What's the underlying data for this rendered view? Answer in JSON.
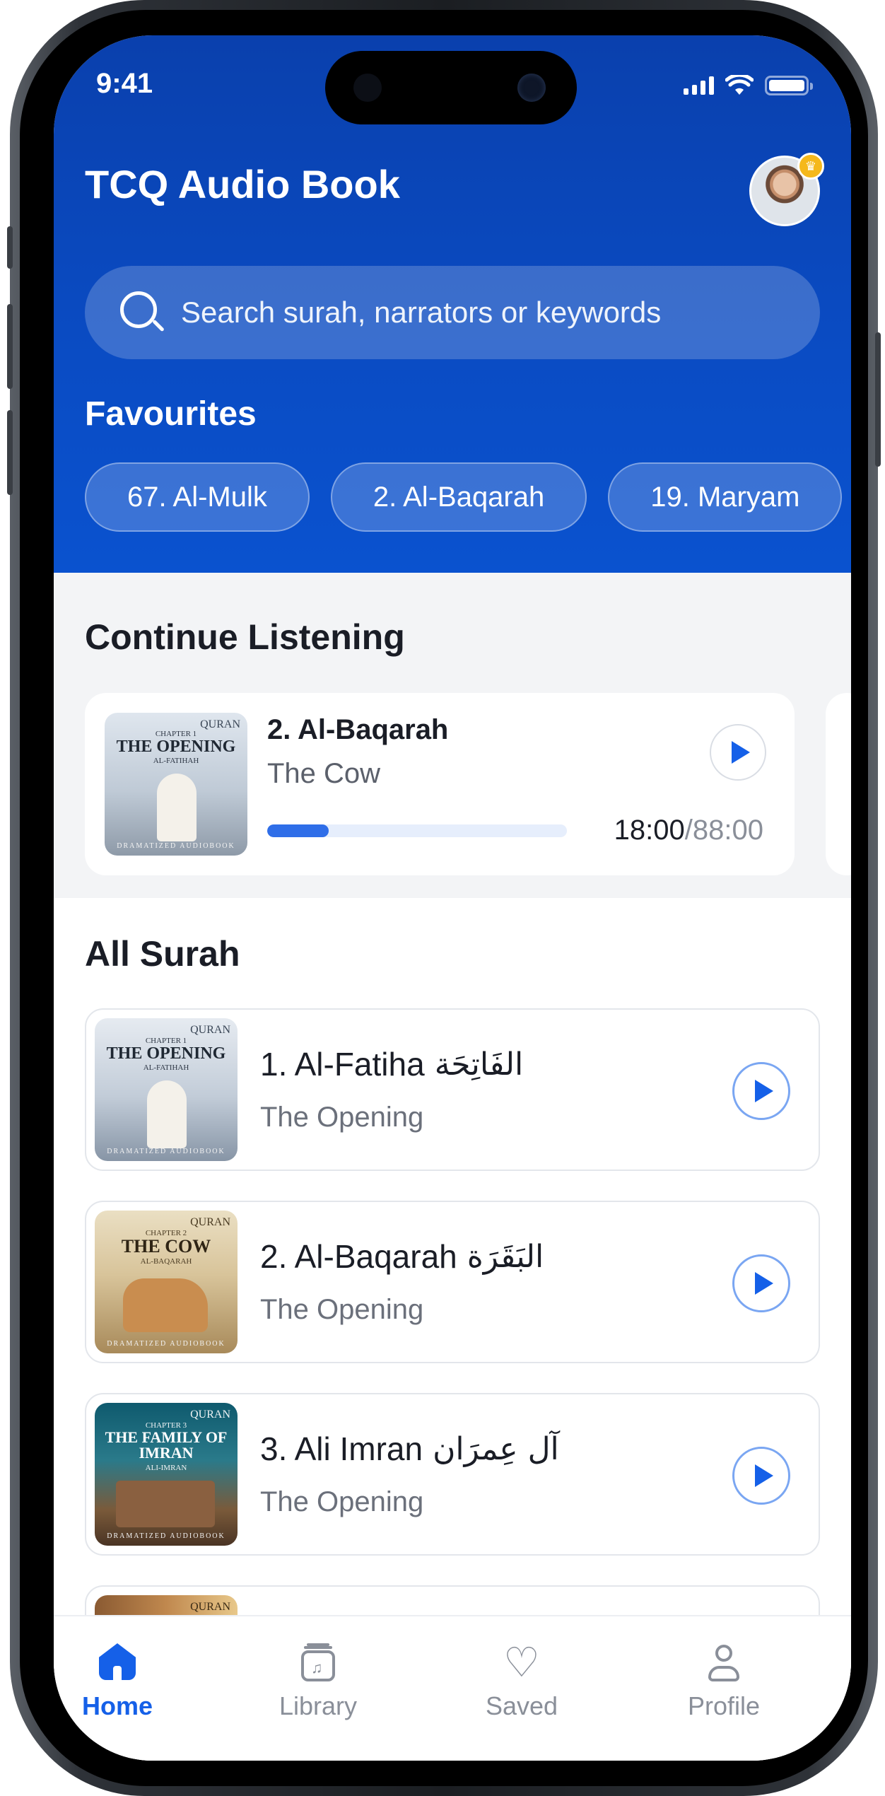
{
  "status_bar": {
    "time": "9:41"
  },
  "header": {
    "title": "TCQ Audio Book"
  },
  "search": {
    "placeholder": "Search surah, narrators or keywords"
  },
  "favourites": {
    "title": "Favourites",
    "chips": [
      "67. Al-Mulk",
      "2. Al-Baqarah",
      "19. Maryam"
    ]
  },
  "continue_listening": {
    "title": "Continue Listening",
    "item": {
      "cover_title": "THE OPENING",
      "cover_chapter": "CHAPTER 1",
      "cover_sub": "AL-FATIHAH",
      "name": "2. Al-Baqarah",
      "subtitle": "The Cow",
      "progress": 0.2045,
      "current": "18:00",
      "total": "/88:00"
    }
  },
  "all_surah": {
    "title": "All Surah",
    "cover_brand": "QURAN",
    "cover_footer": "DRAMATIZED AUDIOBOOK",
    "items": [
      {
        "name": "1. Al-Fatiha",
        "arabic": "الفَاتِحَة",
        "subtitle": "The Opening",
        "cover_chapter": "CHAPTER 1",
        "cover_title": "THE OPENING",
        "cover_sub": "AL-FATIHAH"
      },
      {
        "name": "2. Al-Baqarah",
        "arabic": "البَقَرَة",
        "subtitle": "The Opening",
        "cover_chapter": "CHAPTER 2",
        "cover_title": "THE COW",
        "cover_sub": "AL-BAQARAH"
      },
      {
        "name": "3. Ali Imran",
        "arabic": "آل عِمرَان",
        "subtitle": "The Opening",
        "cover_chapter": "CHAPTER 3",
        "cover_title": "THE FAMILY OF IMRAN",
        "cover_sub": "ALI-IMRAN"
      }
    ]
  },
  "nav": {
    "items": [
      {
        "label": "Home",
        "icon": "home-icon",
        "active": true
      },
      {
        "label": "Library",
        "icon": "library-icon",
        "active": false
      },
      {
        "label": "Saved",
        "icon": "heart-icon",
        "active": false
      },
      {
        "label": "Profile",
        "icon": "profile-icon",
        "active": false
      }
    ]
  },
  "colors": {
    "primary": "#0a4cc4",
    "accent": "#1560e8",
    "progress": "#2f6ee8",
    "premium_badge": "#f5b81c"
  }
}
